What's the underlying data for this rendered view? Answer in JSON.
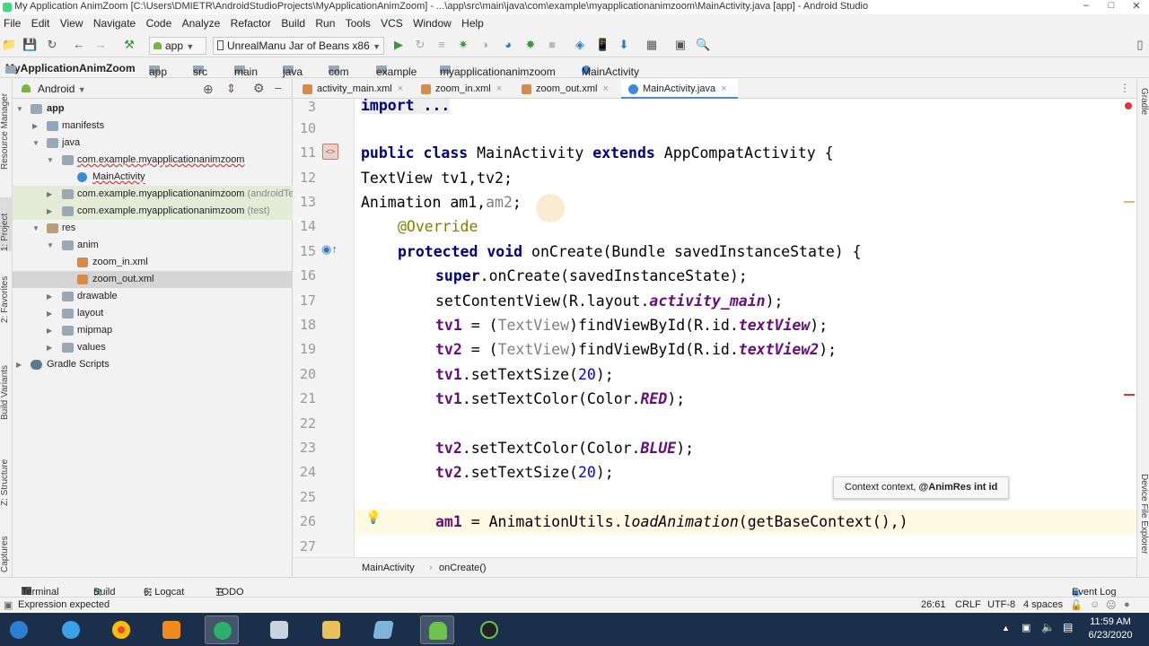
{
  "window": {
    "title": "My Application AnimZoom [C:\\Users\\DMIETR\\AndroidStudioProjects\\MyApplicationAnimZoom] - ...\\app\\src\\main\\java\\com\\example\\myapplicationanimzoom\\MainActivity.java [app] - Android Studio"
  },
  "menu": [
    "File",
    "Edit",
    "View",
    "Navigate",
    "Code",
    "Analyze",
    "Refactor",
    "Build",
    "Run",
    "Tools",
    "VCS",
    "Window",
    "Help"
  ],
  "toolbar": {
    "module": "app",
    "device": "UnrealManu Jar of Beans x86"
  },
  "breadcrumb": [
    "MyApplicationAnimZoom",
    "app",
    "src",
    "main",
    "java",
    "com",
    "example",
    "myapplicationanimzoom",
    "MainActivity"
  ],
  "left_strip": [
    "Resource Manager",
    "1: Project",
    "2: Favorites",
    "Build Variants",
    "Z: Structure",
    "Captures"
  ],
  "right_strip": [
    "Gradle",
    "Device File Explorer"
  ],
  "project": {
    "view": "Android",
    "tree": [
      {
        "label": "app",
        "bold": true
      },
      {
        "label": "manifests"
      },
      {
        "label": "java"
      },
      {
        "label": "com.example.myapplicationanimzoom"
      },
      {
        "label": "MainActivity"
      },
      {
        "label": "com.example.myapplicationanimzoom",
        "suffix": "(androidTest)"
      },
      {
        "label": "com.example.myapplicationanimzoom",
        "suffix": "(test)"
      },
      {
        "label": "res"
      },
      {
        "label": "anim"
      },
      {
        "label": "zoom_in.xml"
      },
      {
        "label": "zoom_out.xml"
      },
      {
        "label": "drawable"
      },
      {
        "label": "layout"
      },
      {
        "label": "mipmap"
      },
      {
        "label": "values"
      },
      {
        "label": "Gradle Scripts"
      }
    ]
  },
  "tabs": [
    "activity_main.xml",
    "zoom_in.xml",
    "zoom_out.xml",
    "MainActivity.java"
  ],
  "editor": {
    "line_numbers": [
      "3",
      "10",
      "11",
      "12",
      "13",
      "14",
      "15",
      "16",
      "17",
      "18",
      "19",
      "20",
      "21",
      "22",
      "23",
      "24",
      "25",
      "26",
      "27"
    ],
    "code": {
      "l3": "import ...",
      "l11a": "public class ",
      "l11b": "MainActivity ",
      "l11c": "extends ",
      "l11d": "AppCompatActivity {",
      "l12": "TextView tv1,tv2;",
      "l13a": "Animation am1,",
      "l13b": "am2",
      "l13c": ";",
      "l14": "@Override",
      "l15a": "protected void ",
      "l15b": "onCreate(Bundle savedInstanceState) {",
      "l16a": "super",
      "l16b": ".onCreate(savedInstanceState);",
      "l17a": "setContentView(R.layout.",
      "l17b": "activity_main",
      "l17c": ");",
      "l18a": "tv1",
      "l18b": " = (",
      "l18c": "TextView",
      "l18d": ")findViewById(R.id.",
      "l18e": "textView",
      "l18f": ");",
      "l19a": "tv2",
      "l19b": " = (",
      "l19c": "TextView",
      "l19d": ")findViewById(R.id.",
      "l19e": "textView2",
      "l19f": ");",
      "l20a": "tv1",
      "l20b": ".setTextSize(",
      "l20c": "20",
      "l20d": ");",
      "l21a": "tv1",
      "l21b": ".setTextColor(Color.",
      "l21c": "RED",
      "l21d": ");",
      "l23a": "tv2",
      "l23b": ".setTextColor(Color.",
      "l23c": "BLUE",
      "l23d": ");",
      "l24a": "tv2",
      "l24b": ".setTextSize(",
      "l24c": "20",
      "l24d": ");",
      "l26a": "am1",
      "l26b": " = AnimationUtils.",
      "l26c": "loadAnimation",
      "l26d": "(getBaseContext(),)"
    },
    "tooltip": {
      "plain": "Context context, ",
      "bold": "@AnimRes int id"
    },
    "crumb": [
      "MainActivity",
      "onCreate()"
    ]
  },
  "bottom_tools": [
    "Terminal",
    "Build",
    "6: Logcat",
    "TODO",
    "Event Log"
  ],
  "status": {
    "message": "Expression expected",
    "position": "26:61",
    "line_sep": "CRLF",
    "encoding": "UTF-8",
    "indent": "4 spaces"
  },
  "taskbar": {
    "time": "11:59 AM",
    "date": "6/23/2020"
  },
  "colors": {
    "keyword": "#000080",
    "annotation": "#808000",
    "constant": "#660e7a",
    "number": "#0000ff",
    "tab_accent": "#4a8bd3",
    "taskbar": "#1c2f4a"
  }
}
